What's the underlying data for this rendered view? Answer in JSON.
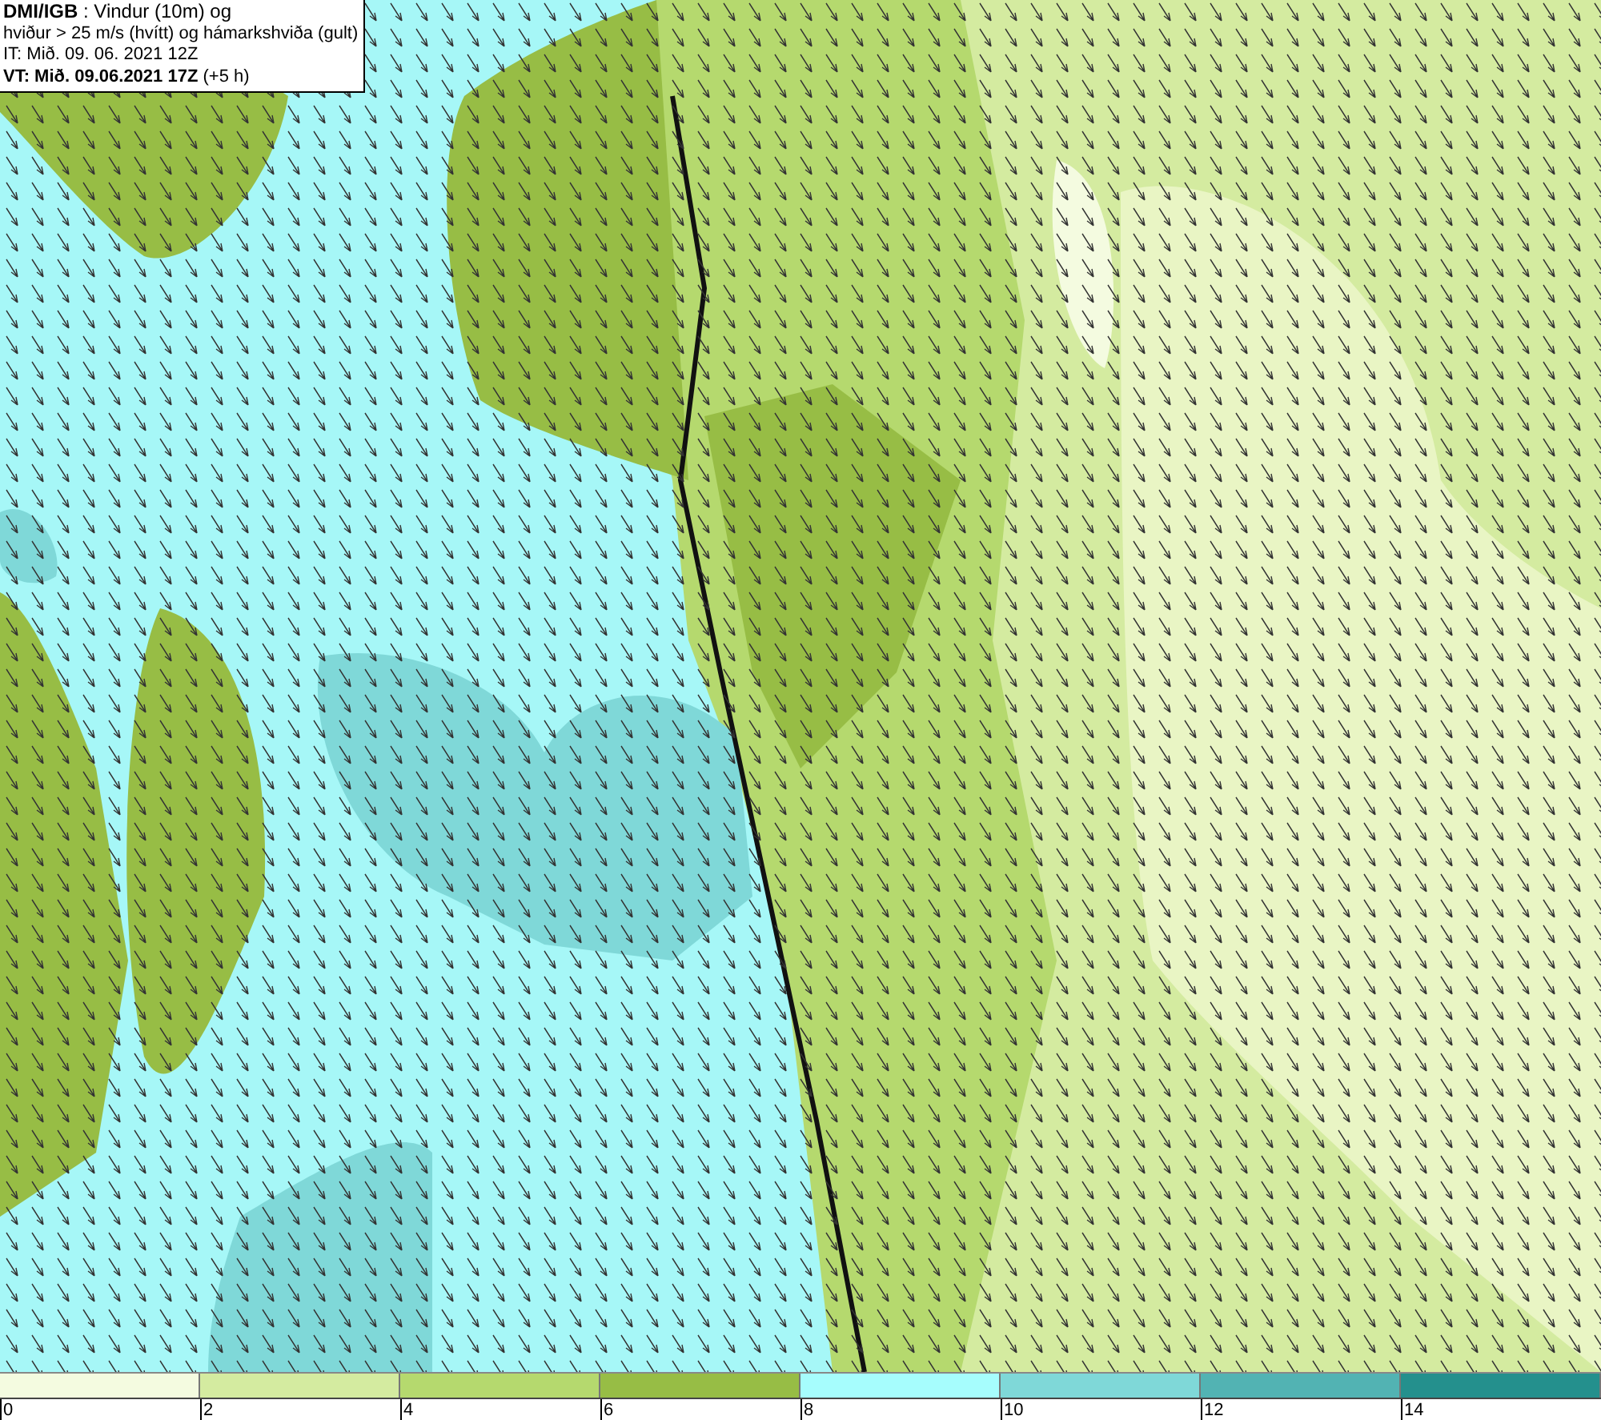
{
  "header": {
    "lines": [
      "**DMI/IGB** : Vindur (10m) og",
      "hviður > 25 m/s (hvítt) og hámarkshviða (gult)",
      "IT: Mið. 09. 06. 2021 12Z",
      "**VT: Mið. 09.06.2021 17Z** (+5 h)"
    ]
  },
  "legend": {
    "segments": [
      {
        "color": "#f4fbe0"
      },
      {
        "color": "#d4eba0"
      },
      {
        "color": "#b5d96e"
      },
      {
        "color": "#97bd45"
      },
      {
        "color": "#a6fdfd"
      },
      {
        "color": "#7fd8d8"
      },
      {
        "color": "#52b3b3"
      },
      {
        "color": "#24908d"
      }
    ],
    "ticks": [
      "0",
      "2",
      "4",
      "6",
      "8",
      "10",
      "12",
      "14"
    ]
  }
}
